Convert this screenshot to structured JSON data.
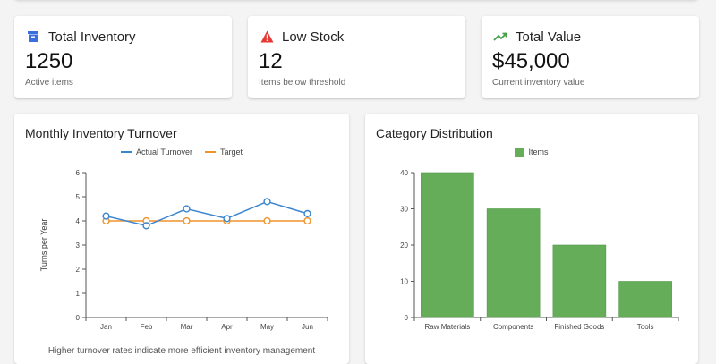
{
  "stats": [
    {
      "title": "Total Inventory",
      "value": "1250",
      "subtitle": "Active items",
      "icon": "archive-box-icon",
      "color": "#3b6fe0"
    },
    {
      "title": "Low Stock",
      "value": "12",
      "subtitle": "Items below threshold",
      "icon": "warning-triangle-icon",
      "color": "#e53935"
    },
    {
      "title": "Total Value",
      "value": "$45,000",
      "subtitle": "Current inventory value",
      "icon": "trending-up-icon",
      "color": "#43a047"
    }
  ],
  "turnover": {
    "title": "Monthly Inventory Turnover",
    "caption": "Higher turnover rates indicate more efficient inventory management",
    "legend": [
      "Actual Turnover",
      "Target"
    ],
    "ylabel": "Turns per Year"
  },
  "distribution": {
    "title": "Category Distribution",
    "legend": [
      "Items"
    ]
  },
  "chart_data": [
    {
      "type": "line",
      "title": "Monthly Inventory Turnover",
      "xlabel": "",
      "ylabel": "Turns per Year",
      "categories": [
        "Jan",
        "Feb",
        "Mar",
        "Apr",
        "May",
        "Jun"
      ],
      "series": [
        {
          "name": "Actual Turnover",
          "values": [
            4.2,
            3.8,
            4.5,
            4.1,
            4.8,
            4.3
          ],
          "color": "#3a86d0"
        },
        {
          "name": "Target",
          "values": [
            4,
            4,
            4,
            4,
            4,
            4
          ],
          "color": "#f0932b"
        }
      ],
      "ylim": [
        0,
        6
      ],
      "yticks": [
        0,
        1,
        2,
        3,
        4,
        5,
        6
      ],
      "grid": false,
      "legend": "top"
    },
    {
      "type": "bar",
      "title": "Category Distribution",
      "categories": [
        "Raw Materials",
        "Components",
        "Finished Goods",
        "Tools"
      ],
      "series": [
        {
          "name": "Items",
          "values": [
            40,
            30,
            20,
            10
          ],
          "color": "#66ad5a"
        }
      ],
      "ylim": [
        0,
        40
      ],
      "yticks": [
        0,
        10,
        20,
        30,
        40
      ],
      "grid": false,
      "legend": "top"
    }
  ]
}
